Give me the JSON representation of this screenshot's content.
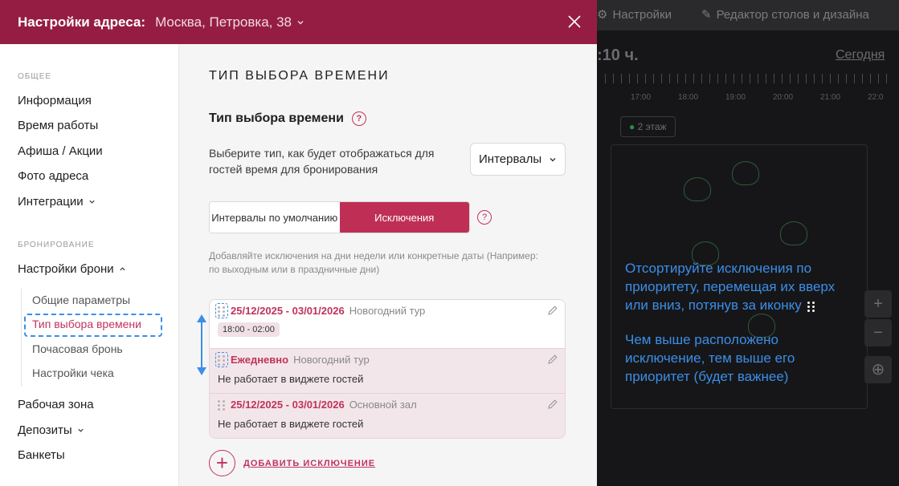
{
  "background": {
    "topbar": {
      "settings_label": "Настройки",
      "editor_label": "Редактор столов и дизайна"
    },
    "time_label": ":10 ч.",
    "today_label": "Сегодня",
    "ruler_labels": [
      "17:00",
      "18:00",
      "19:00",
      "20:00",
      "21:00",
      "22:0"
    ],
    "chip_floor": "2 этаж"
  },
  "tooltip": {
    "line1": "Отсортируйте исключения по приоритету, перемещая их вверх или вниз, потянув за иконку",
    "line2": "Чем выше расположено исключение, тем выше его приоритет (будет важнее)"
  },
  "header": {
    "title": "Настройки адреса:",
    "address": "Москва, Петровка, 38"
  },
  "sidebar": {
    "section_general": "ОБЩЕЕ",
    "items_general": [
      "Информация",
      "Время работы",
      "Афиша / Акции",
      "Фото адреса",
      "Интеграции"
    ],
    "section_booking": "БРОНИРОВАНИЕ",
    "booking_settings": "Настройки брони",
    "sub_items": [
      "Общие параметры",
      "Тип выбора времени",
      "Почасовая бронь",
      "Настройки чека"
    ],
    "items_bottom": [
      "Рабочая зона",
      "Депозиты",
      "Банкеты"
    ]
  },
  "content": {
    "page_title": "ТИП ВЫБОРА ВРЕМЕНИ",
    "subtitle": "Тип выбора времени",
    "description": "Выберите тип, как будет отображаться для гостей время для бронирования",
    "select_value": "Интервалы",
    "tabs": [
      "Интервалы по умолчанию",
      "Исключения"
    ],
    "hint": "Добавляйте исключения на дни недели или конкретные даты (Например: по выходным или в праздничные дни)",
    "exceptions": [
      {
        "date": "25/12/2025 - 03/01/2026",
        "zone": "Новогодний тур",
        "chip": "18:00 - 02:00",
        "text": ""
      },
      {
        "date": "Ежедневно",
        "zone": "Новогодний тур",
        "chip": "",
        "text": "Не работает в виджете гостей"
      },
      {
        "date": "25/12/2025 - 03/01/2026",
        "zone": "Основной зал",
        "chip": "",
        "text": "Не работает в виджете гостей"
      }
    ],
    "add_label": "ДОБАВИТЬ ИСКЛЮЧЕНИЕ"
  },
  "colors": {
    "brand": "#951d43",
    "accent": "#bf2f55",
    "annotation": "#3b8ee8"
  }
}
